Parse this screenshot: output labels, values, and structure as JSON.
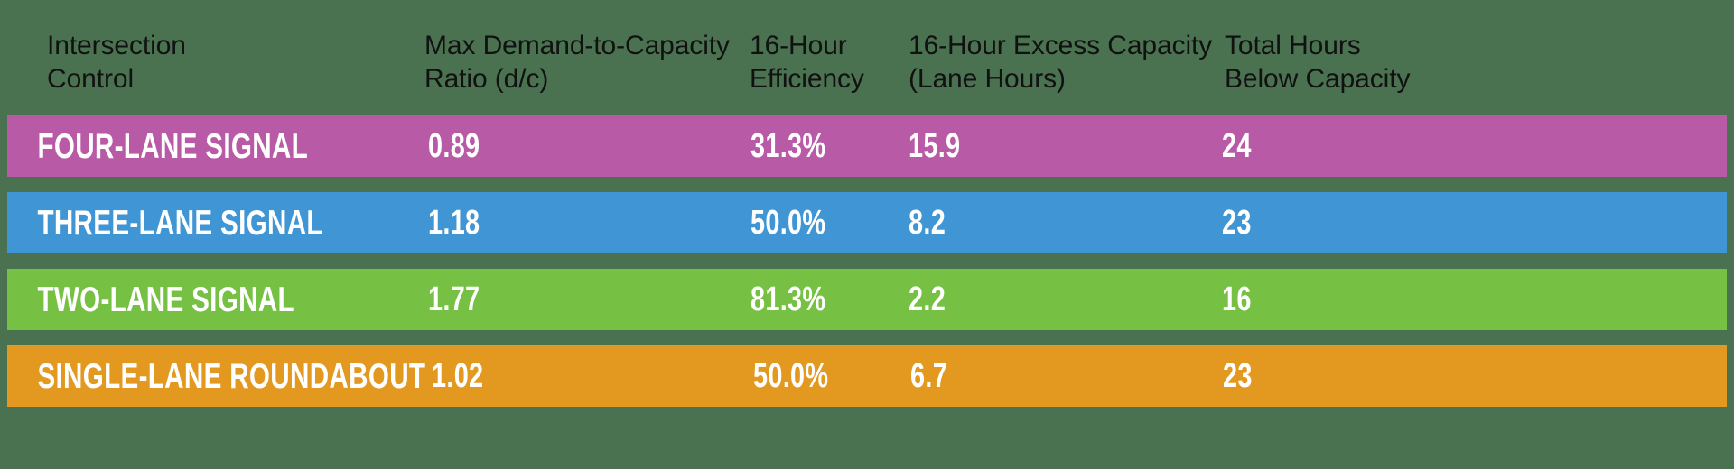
{
  "theme": {
    "background": "#4a7150",
    "header_text": "#111111",
    "row_text": "#ffffff"
  },
  "table": {
    "columns": [
      "Intersection\nControl",
      "Max Demand-to-Capacity\nRatio (d/c)",
      "16-Hour\nEfficiency",
      "16-Hour Excess Capacity\n(Lane Hours)",
      "Total Hours\nBelow Capacity"
    ],
    "rows": [
      {
        "name": "FOUR-LANE SIGNAL",
        "max_dc_ratio": "0.89",
        "efficiency_16hr": "31.3%",
        "excess_capacity_lane_hours": "15.9",
        "total_hours_below_capacity": "24",
        "color": "#b85aa5"
      },
      {
        "name": "THREE-LANE SIGNAL",
        "max_dc_ratio": "1.18",
        "efficiency_16hr": "50.0%",
        "excess_capacity_lane_hours": "8.2",
        "total_hours_below_capacity": "23",
        "color": "#4096d4"
      },
      {
        "name": "TWO-LANE SIGNAL",
        "max_dc_ratio": "1.77",
        "efficiency_16hr": "81.3%",
        "excess_capacity_lane_hours": "2.2",
        "total_hours_below_capacity": "16",
        "color": "#76c044"
      },
      {
        "name": "SINGLE-LANE ROUNDABOUT",
        "max_dc_ratio": "1.02",
        "efficiency_16hr": "50.0%",
        "excess_capacity_lane_hours": "6.7",
        "total_hours_below_capacity": "23",
        "color": "#e3981f"
      }
    ]
  },
  "chart_data": {
    "type": "table",
    "title": "",
    "columns": [
      "Intersection Control",
      "Max Demand-to-Capacity Ratio (d/c)",
      "16-Hour Efficiency",
      "16-Hour Excess Capacity (Lane Hours)",
      "Total Hours Below Capacity"
    ],
    "rows": [
      [
        "FOUR-LANE SIGNAL",
        0.89,
        "31.3%",
        15.9,
        24
      ],
      [
        "THREE-LANE SIGNAL",
        1.18,
        "50.0%",
        8.2,
        23
      ],
      [
        "TWO-LANE SIGNAL",
        1.77,
        "81.3%",
        2.2,
        16
      ],
      [
        "SINGLE-LANE ROUNDABOUT",
        1.02,
        "50.0%",
        6.7,
        23
      ]
    ],
    "row_colors": [
      "#b85aa5",
      "#4096d4",
      "#76c044",
      "#e3981f"
    ]
  }
}
